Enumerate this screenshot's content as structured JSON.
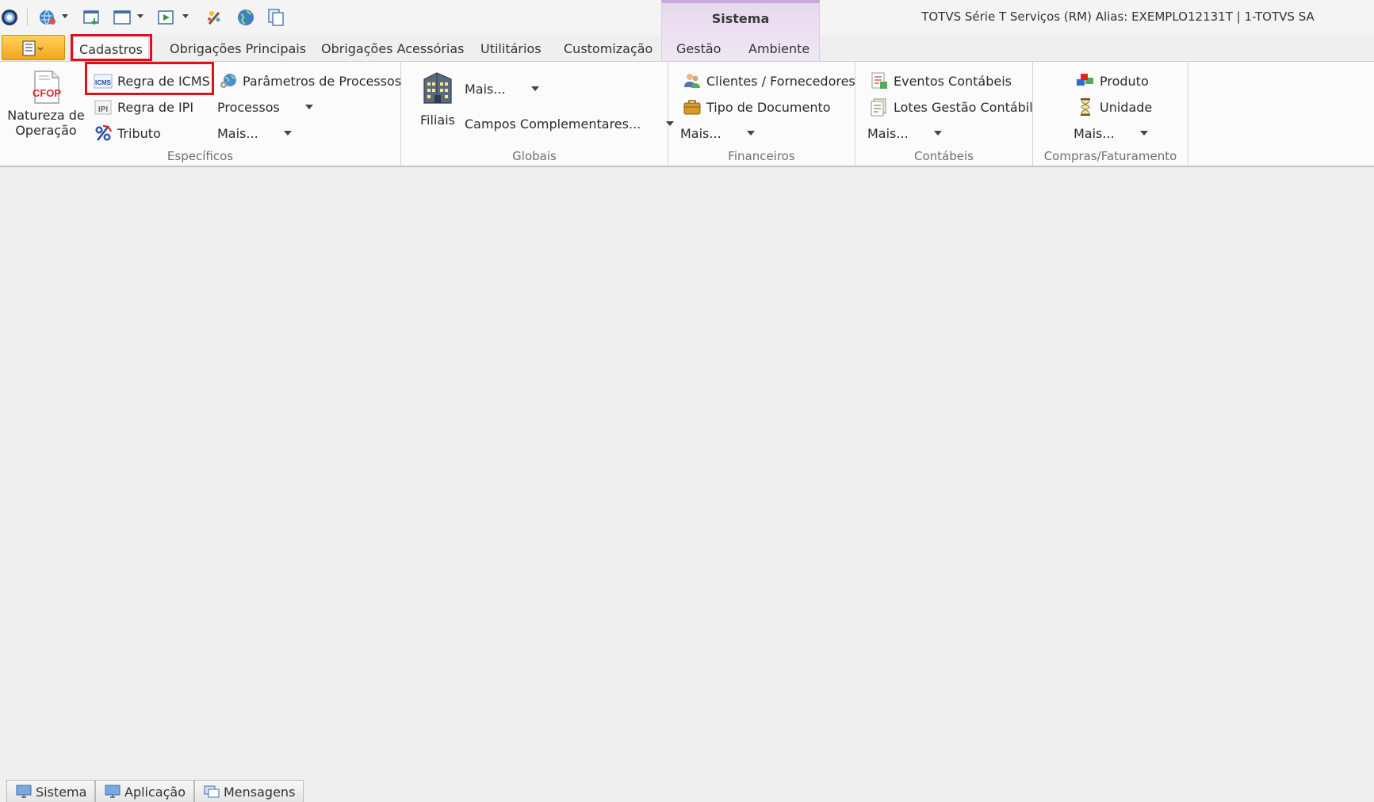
{
  "window": {
    "title": "TOTVS Série T Serviços (RM) Alias: EXEMPLO12131T | 1-TOTVS SA",
    "context_tab": "Sistema"
  },
  "quick_access": [
    {
      "icon": "app-orb-icon"
    },
    {
      "icon": "globe-settings-icon"
    },
    {
      "icon": "window-download-icon"
    },
    {
      "icon": "window-layout-icon"
    },
    {
      "icon": "export-window-icon"
    },
    {
      "icon": "magic-wand-icon"
    },
    {
      "icon": "world-icon"
    },
    {
      "icon": "copy-pages-icon"
    }
  ],
  "tabs": [
    {
      "label": "Cadastros",
      "active": true
    },
    {
      "label": "Obrigações Principais"
    },
    {
      "label": "Obrigações Acessórias"
    },
    {
      "label": "Utilitários"
    },
    {
      "label": "Customização"
    },
    {
      "label": "Gestão"
    },
    {
      "label": "Ambiente"
    }
  ],
  "ribbon": {
    "especificos": {
      "label": "Específicos",
      "natureza": {
        "label_line1": "Natureza de",
        "label_line2": "Operação",
        "icon": "cfop-document-icon",
        "icon_text": "CFOP"
      },
      "regra_icms": {
        "label": "Regra de ICMS",
        "icon": "icms-icon",
        "icon_text": "ICMS"
      },
      "regra_ipi": {
        "label": "Regra de IPI",
        "icon": "ipi-icon",
        "icon_text": "IPI"
      },
      "tributo": {
        "label": "Tributo",
        "icon": "percent-icon"
      },
      "parametros": {
        "label": "Parâmetros de Processos",
        "icon": "process-params-icon"
      },
      "processos": {
        "label": "Processos"
      },
      "mais": {
        "label": "Mais..."
      }
    },
    "globais": {
      "label": "Globais",
      "filiais": {
        "label": "Filiais",
        "icon": "building-icon"
      },
      "mais": {
        "label": "Mais..."
      },
      "campos": {
        "label": "Campos Complementares..."
      }
    },
    "financeiros": {
      "label": "Financeiros",
      "clientes": {
        "label": "Clientes / Fornecedores",
        "icon": "users-icon"
      },
      "tipo_documento": {
        "label": "Tipo de Documento",
        "icon": "briefcase-icon"
      },
      "mais": {
        "label": "Mais..."
      }
    },
    "contabeis": {
      "label": "Contábeis",
      "eventos": {
        "label": "Eventos Contábeis",
        "icon": "accounting-events-icon"
      },
      "lotes": {
        "label": "Lotes Gestão Contábil",
        "icon": "accounting-batches-icon"
      },
      "mais": {
        "label": "Mais..."
      }
    },
    "compras": {
      "label": "Compras/Faturamento",
      "produto": {
        "label": "Produto",
        "icon": "product-icon"
      },
      "unidade": {
        "label": "Unidade",
        "icon": "hourglass-icon"
      },
      "mais": {
        "label": "Mais..."
      }
    }
  },
  "bottom_tabs": [
    {
      "label": "Sistema",
      "icon": "monitor-icon"
    },
    {
      "label": "Aplicação",
      "icon": "monitor-icon"
    },
    {
      "label": "Mensagens",
      "icon": "messages-icon"
    }
  ],
  "colors": {
    "highlight": "#e0101a",
    "file_button": "#f2a51a",
    "context_tab": "#c9a9d8"
  }
}
